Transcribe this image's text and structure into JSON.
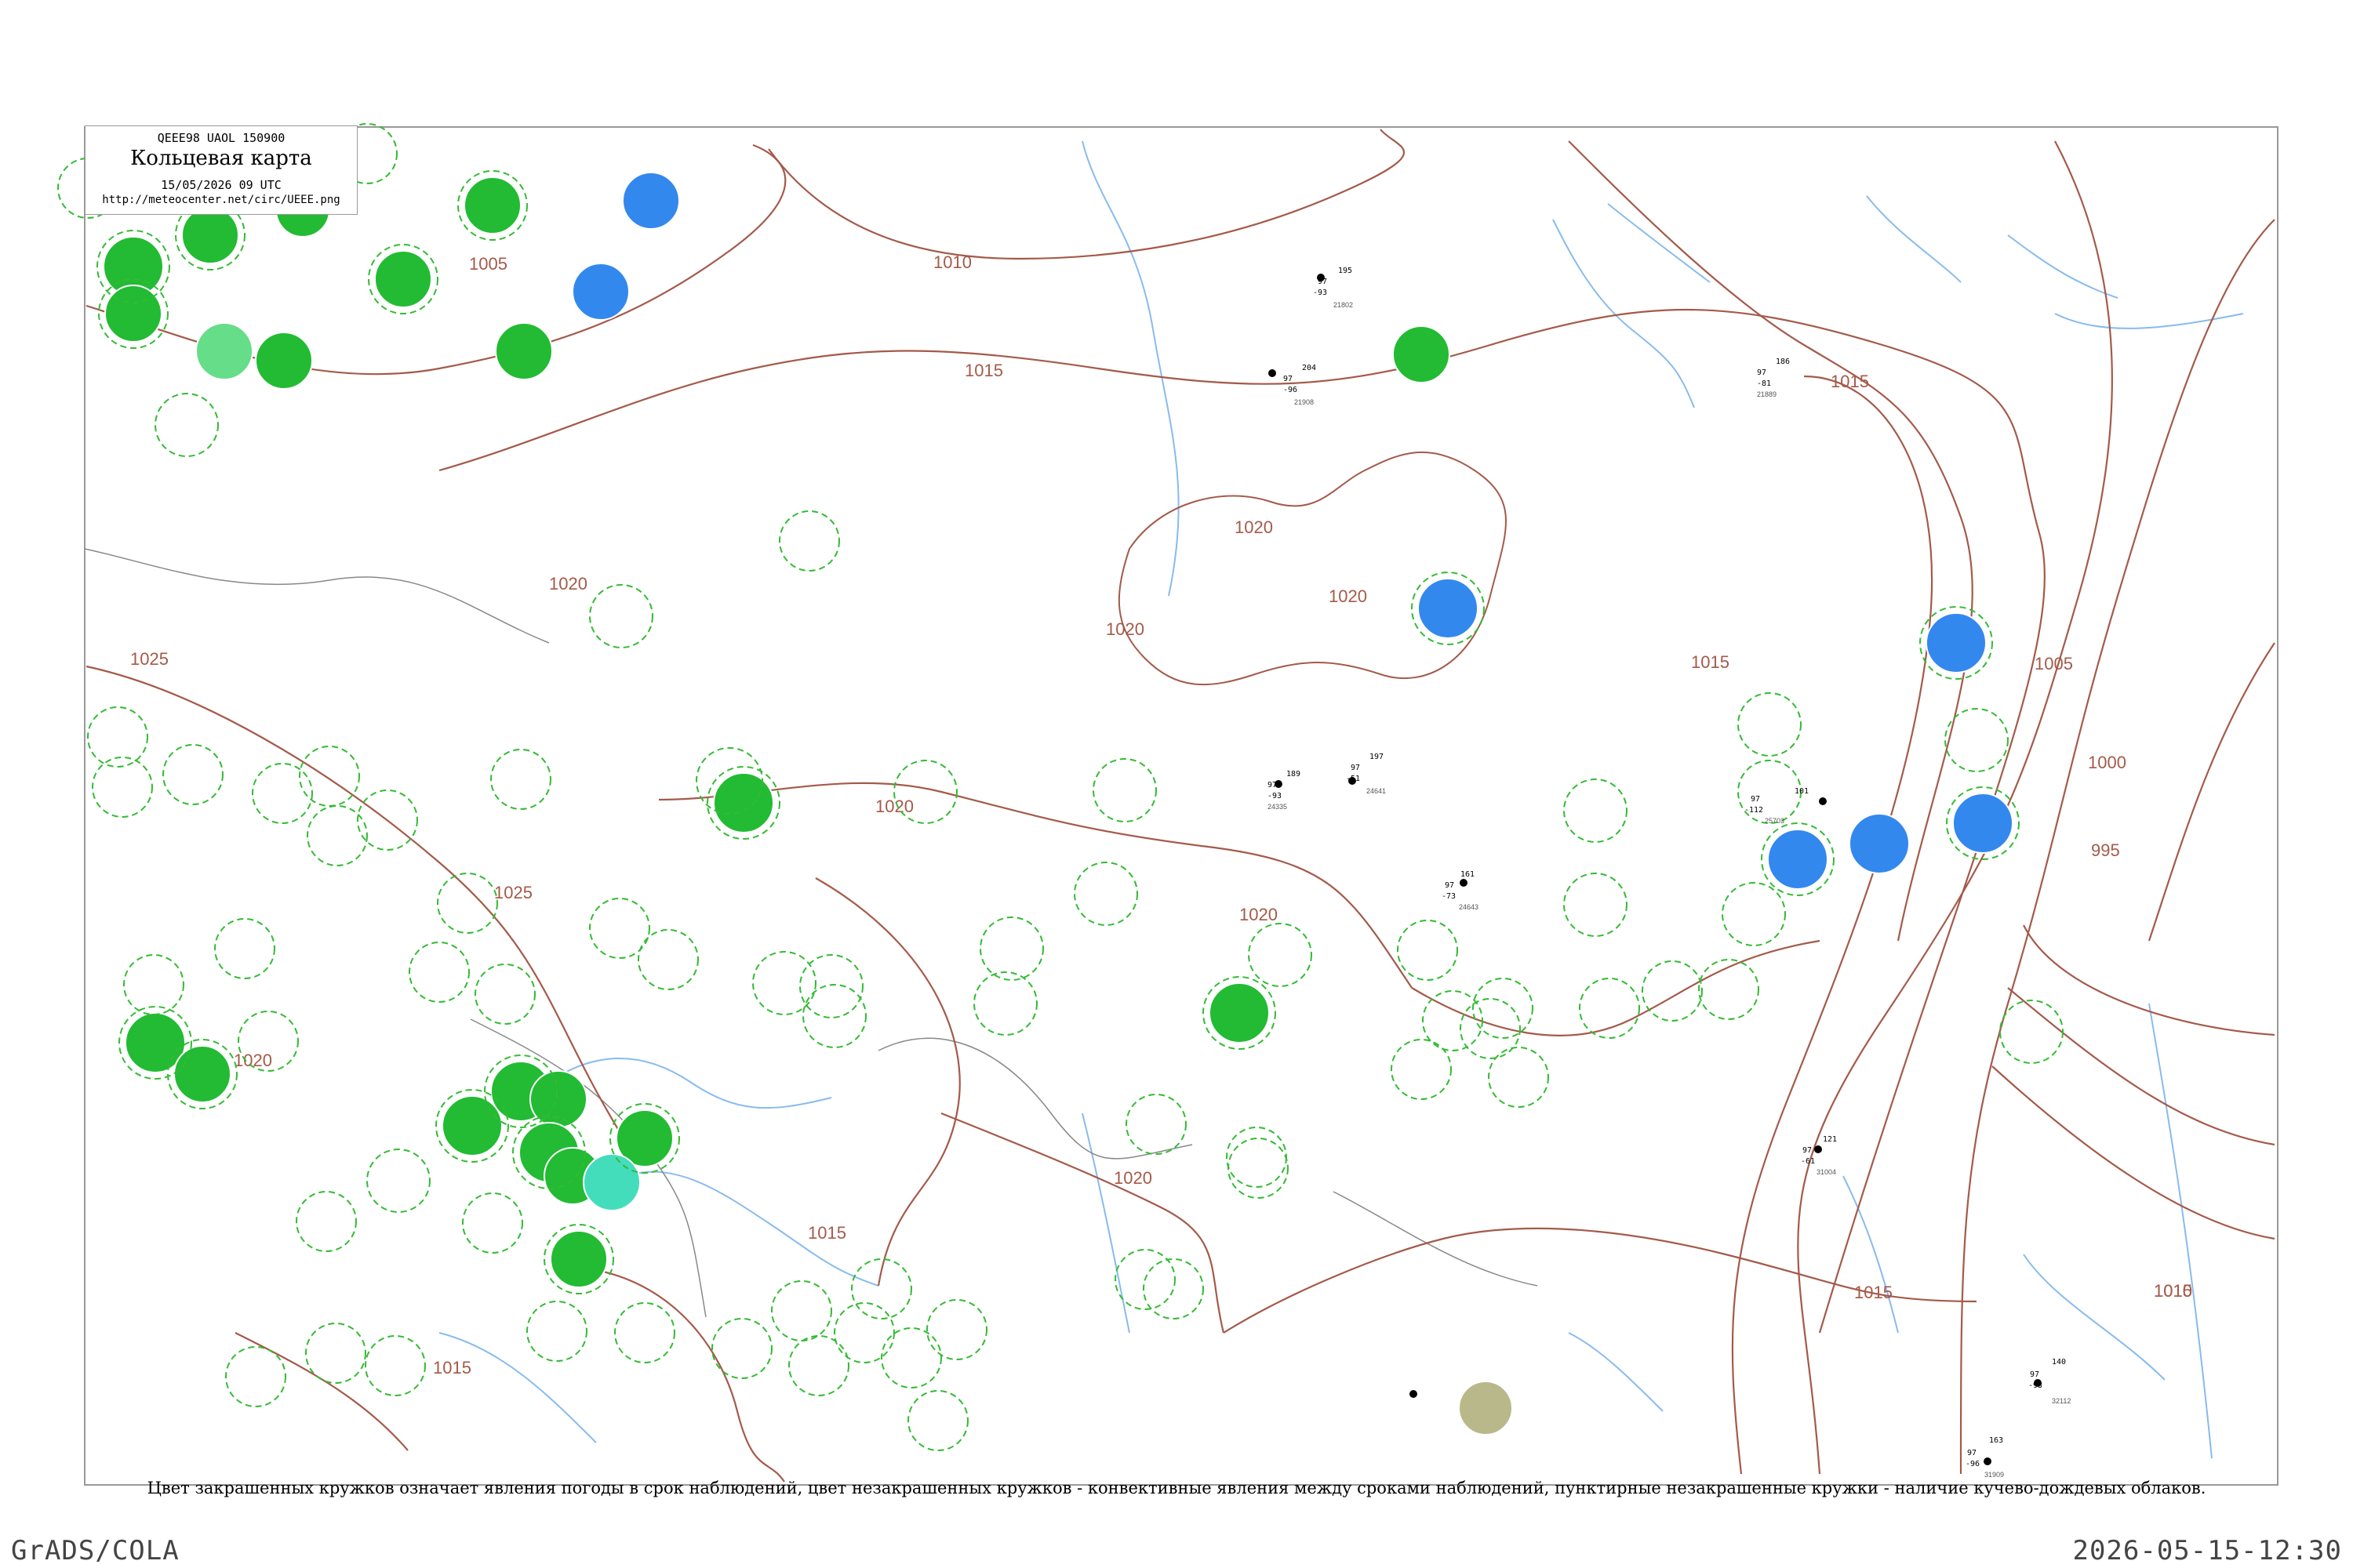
{
  "legend": {
    "code": "QEEE98  UAOL  150900",
    "title": "Кольцевая карта",
    "time": "15/05/2026 09 UTC",
    "url": "http://meteocenter.net/circ/UEEE.png"
  },
  "caption": "Цвет закрашенных кружков означает явления погоды в срок наблюдений, цвет незакрашенных кружков - конвективные явления между сроками наблюдений, пунктирные незакрашенные кружки - наличие кучево-дождевых облаков.",
  "credit": "GrADS/COLA",
  "timestamp": "2026-05-15-12:30",
  "colors": {
    "isobar": "#a45a4a",
    "rain_fill": "#22bb33",
    "shower_fill": "#3388ee",
    "light_rain_fill": "#66dd88",
    "drizzle_fill": "#44ddbb",
    "haze_fill": "#b8b88a",
    "cb_ring": "#33bb33",
    "rivers": "#88bbee",
    "borders": "#888888"
  },
  "isobars": [
    {
      "label": "1005",
      "value": 1005
    },
    {
      "label": "1010",
      "value": 1010
    },
    {
      "label": "1015",
      "value": 1015
    },
    {
      "label": "1020",
      "value": 1020
    },
    {
      "label": "1025",
      "value": 1025
    },
    {
      "label": "1000",
      "value": 1000
    },
    {
      "label": "995",
      "value": 995
    }
  ],
  "station_examples": [
    {
      "temp": "97",
      "pressure": "189",
      "dew": "-93",
      "index": "24335"
    },
    {
      "temp": "97",
      "pressure": "204",
      "dew": "-96",
      "index": "21908"
    },
    {
      "temp": "97",
      "pressure": "186",
      "dew": "-81",
      "index": "21889"
    },
    {
      "temp": "97",
      "pressure": "195",
      "dew": "-93",
      "index": "21802"
    },
    {
      "temp": "97",
      "pressure": "197",
      "dew": "-51",
      "index": "24641"
    },
    {
      "temp": "97",
      "pressure": "161",
      "dew": "-73",
      "index": "24643"
    },
    {
      "temp": "97",
      "pressure": "121",
      "dew": "-61",
      "index": "31004"
    },
    {
      "temp": "97",
      "pressure": "101",
      "dew": "-112",
      "index": "25703"
    },
    {
      "temp": "97",
      "pressure": "140",
      "dew": "-93",
      "index": "32112"
    },
    {
      "temp": "97",
      "pressure": "163",
      "dew": "-96",
      "index": "31909"
    }
  ]
}
